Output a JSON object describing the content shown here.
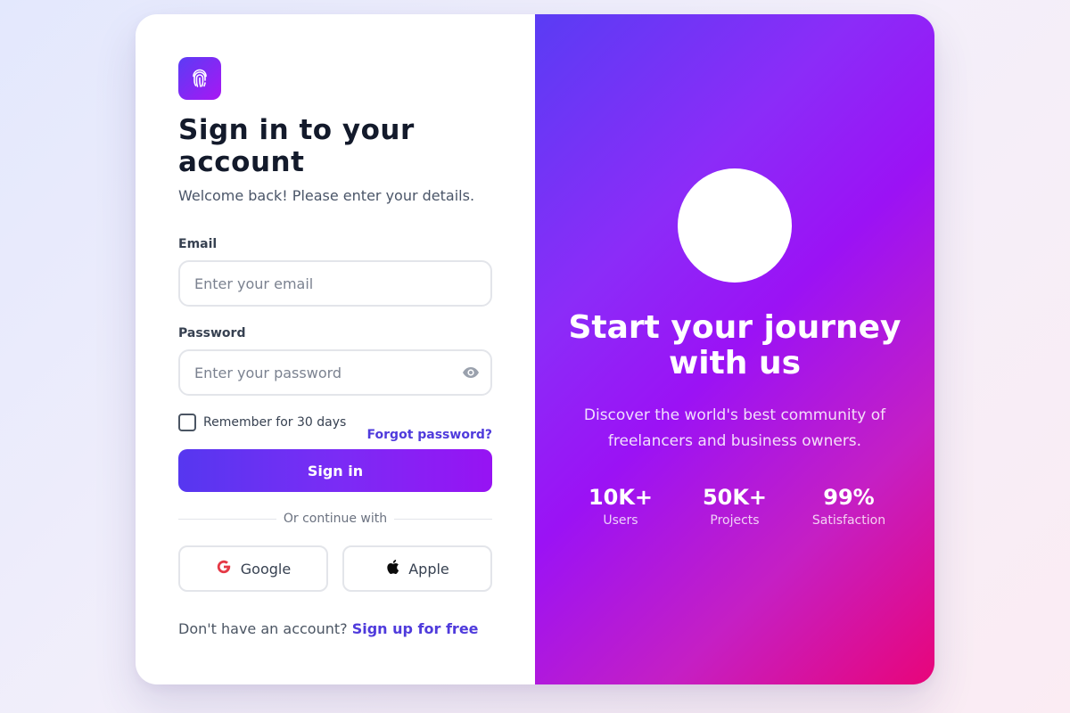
{
  "auth": {
    "title": "Sign in to your account",
    "subtitle": "Welcome back! Please enter your details.",
    "email": {
      "label": "Email",
      "placeholder": "Enter your email",
      "value": ""
    },
    "password": {
      "label": "Password",
      "placeholder": "Enter your password",
      "value": ""
    },
    "remember_label": "Remember for 30 days",
    "remember_checked": false,
    "forgot_label": "Forgot password?",
    "signin_label": "Sign in",
    "divider_text": "Or continue with",
    "google_label": "Google",
    "apple_label": "Apple",
    "signup_prompt": "Don't have an account?",
    "signup_link": "Sign up for free"
  },
  "promo": {
    "title": "Start your journey with us",
    "subtitle": "Discover the world's best community of freelancers and business owners.",
    "stats": [
      {
        "value": "10K+",
        "label": "Users"
      },
      {
        "value": "50K+",
        "label": "Projects"
      },
      {
        "value": "99%",
        "label": "Satisfaction"
      }
    ]
  },
  "icons": {
    "logo": "fingerprint-icon",
    "password_toggle": "eye-icon",
    "google": "google-icon",
    "apple": "apple-icon"
  },
  "colors": {
    "accent": "#4f3bdc",
    "gradient_start": "#5637f0",
    "gradient_end": "#e8057a",
    "title": "#131a2b"
  }
}
